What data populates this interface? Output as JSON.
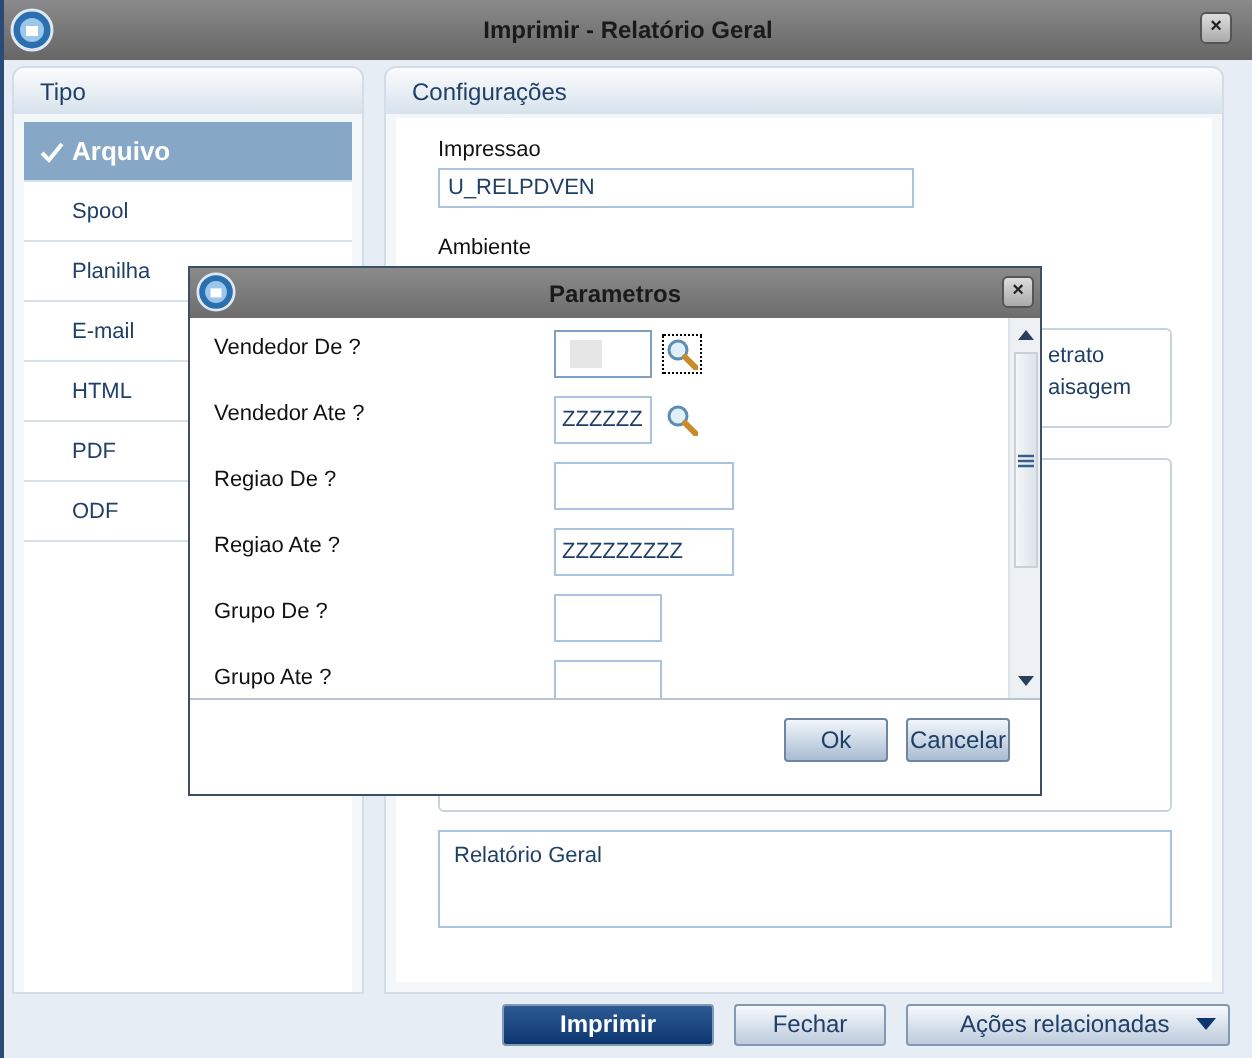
{
  "window": {
    "title": "Imprimir - Relatório Geral",
    "close": "×"
  },
  "tipo": {
    "title": "Tipo",
    "items": [
      {
        "label": "Arquivo",
        "selected": true
      },
      {
        "label": "Spool",
        "selected": false
      },
      {
        "label": "Planilha",
        "selected": false
      },
      {
        "label": "E-mail",
        "selected": false
      },
      {
        "label": "HTML",
        "selected": false
      },
      {
        "label": "PDF",
        "selected": false
      },
      {
        "label": "ODF",
        "selected": false
      }
    ]
  },
  "configuracoes": {
    "title": "Configurações",
    "impressao": {
      "label": "Impressao",
      "value": "U_RELPDVEN"
    },
    "ambiente": {
      "label": "Ambiente"
    },
    "orientation_options": [
      "etrato",
      "aisagem"
    ],
    "description": {
      "value": "Relatório Geral"
    }
  },
  "buttons": [
    {
      "label": "Imprimir",
      "kind": "primary"
    },
    {
      "label": "Fechar",
      "kind": "normal"
    },
    {
      "label": "Ações relacionadas",
      "kind": "dropdown"
    }
  ],
  "dialog": {
    "title": "Parametros",
    "close": "×",
    "params": [
      {
        "label": "Vendedor De ?",
        "kind": "short",
        "lookup": true,
        "focused": true
      },
      {
        "label": "Vendedor Ate ?",
        "value": "ZZZZZZ",
        "kind": "short",
        "lookup": true,
        "focused": false
      },
      {
        "label": "Regiao De ?",
        "kind": "long",
        "lookup": false,
        "focused": false
      },
      {
        "label": "Regiao Ate ?",
        "value": "ZZZZZZZZZ",
        "kind": "long",
        "lookup": false,
        "focused": false
      },
      {
        "label": "Grupo De ?",
        "kind": "medium",
        "lookup": false,
        "focused": false
      },
      {
        "label": "Grupo Ate ?",
        "kind": "medium",
        "lookup": false,
        "focused": false
      }
    ],
    "buttons": [
      {
        "label": "Ok"
      },
      {
        "label": "Cancelar"
      }
    ]
  }
}
